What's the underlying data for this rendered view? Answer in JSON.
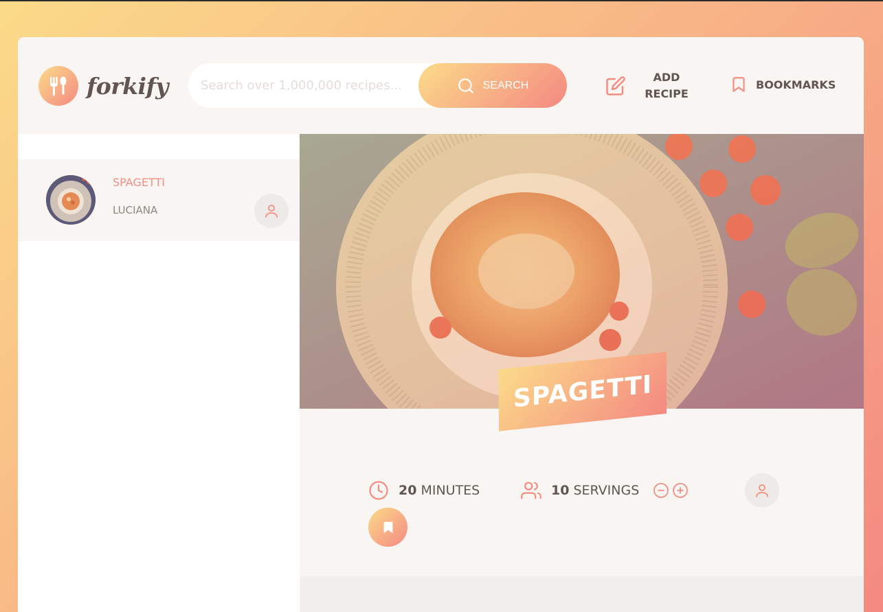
{
  "app": {
    "logo_text": "forkify",
    "accent_gradient": [
      "#fbdb89",
      "#f48982"
    ],
    "text_color": "#615551"
  },
  "search": {
    "placeholder": "Search over 1,000,000 recipes...",
    "button_label": "SEARCH"
  },
  "nav": {
    "add_recipe_label": "ADD RECIPE",
    "bookmarks_label": "BOOKMARKS"
  },
  "results": [
    {
      "title": "SPAGETTI",
      "publisher": "LUCIANA",
      "user_generated": true
    }
  ],
  "recipe": {
    "title": "SPAGETTI",
    "cooking_time": "20",
    "cooking_time_unit": "MINUTES",
    "servings": "10",
    "servings_unit": "SERVINGS",
    "user_generated": true
  },
  "icons": {
    "logo": "fork-spoon-icon",
    "search": "search-icon",
    "add_recipe": "edit-icon",
    "bookmarks": "bookmark-icon",
    "clock": "clock-icon",
    "users": "users-icon",
    "minus": "minus-circle-icon",
    "plus": "plus-circle-icon",
    "user": "user-icon",
    "bookmark_fill": "bookmark-fill-icon"
  }
}
